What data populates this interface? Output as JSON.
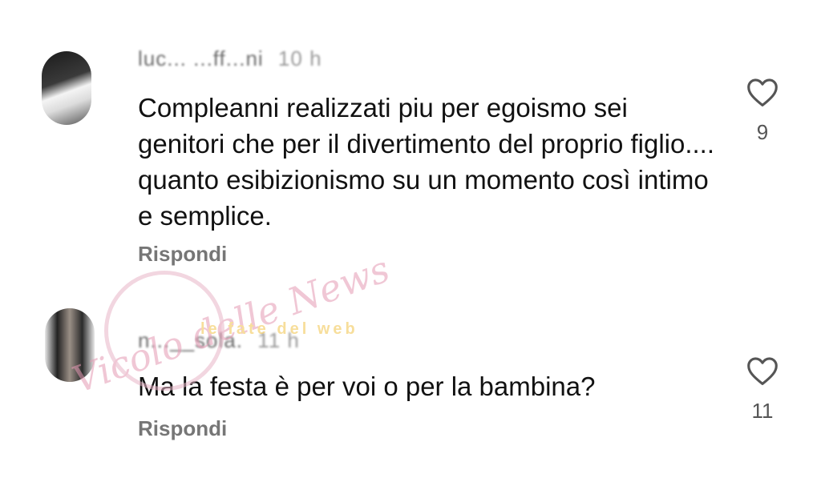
{
  "comments": [
    {
      "username": "luc...  ...ff...ni",
      "time": "10 h",
      "text": "Compleanni realizzati piu per egoismo sei genitori che per il divertimento del proprio figlio.... quanto esibizionismo su un momento così intimo e semplice.",
      "reply_label": "Rispondi",
      "likes": "9"
    },
    {
      "username": "n...__sola.",
      "time": "11 h",
      "text": "Ma la festa è per voi o per la bambina?",
      "reply_label": "Rispondi",
      "likes": "11"
    }
  ],
  "watermark": {
    "script": "Vicolo delle News",
    "band": "le fate del web"
  },
  "colors": {
    "text": "#111111",
    "secondary": "#767676",
    "heart": "#555555"
  }
}
